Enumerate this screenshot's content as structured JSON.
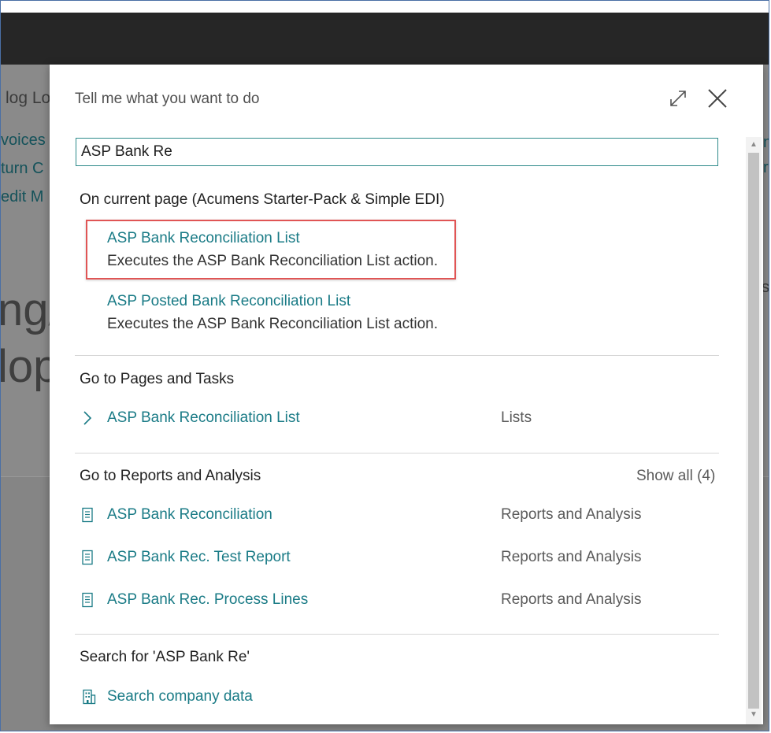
{
  "background": {
    "header_fragment": "log Lo",
    "nav_links": [
      "voices",
      "turn C",
      "edit M"
    ],
    "big_text": [
      "ng/",
      "lop"
    ],
    "right_fragments": [
      "n",
      "r",
      "sl"
    ]
  },
  "dialog": {
    "title": "Tell me what you want to do",
    "search_value": "ASP Bank Re",
    "current_page": {
      "header": "On current page (Acumens Starter-Pack & Simple EDI)",
      "items": [
        {
          "label": "ASP Bank Reconciliation List",
          "description": "Executes the ASP Bank Reconciliation List action."
        },
        {
          "label": "ASP Posted Bank Reconciliation List",
          "description": "Executes the ASP Bank Reconciliation List action."
        }
      ]
    },
    "pages_tasks": {
      "header": "Go to Pages and Tasks",
      "items": [
        {
          "label": "ASP Bank Reconciliation List",
          "category": "Lists"
        }
      ]
    },
    "reports": {
      "header": "Go to Reports and Analysis",
      "show_all": "Show all (4)",
      "items": [
        {
          "label": "ASP Bank Reconciliation",
          "category": "Reports and Analysis"
        },
        {
          "label": "ASP Bank Rec. Test Report",
          "category": "Reports and Analysis"
        },
        {
          "label": "ASP Bank Rec. Process Lines",
          "category": "Reports and Analysis"
        }
      ]
    },
    "search_for": {
      "header": "Search for 'ASP Bank Re'",
      "items": [
        {
          "label": "Search company data"
        }
      ]
    }
  },
  "colors": {
    "accent": "#1a7b86",
    "highlight": "#e05555",
    "top_bar": "#262626"
  }
}
